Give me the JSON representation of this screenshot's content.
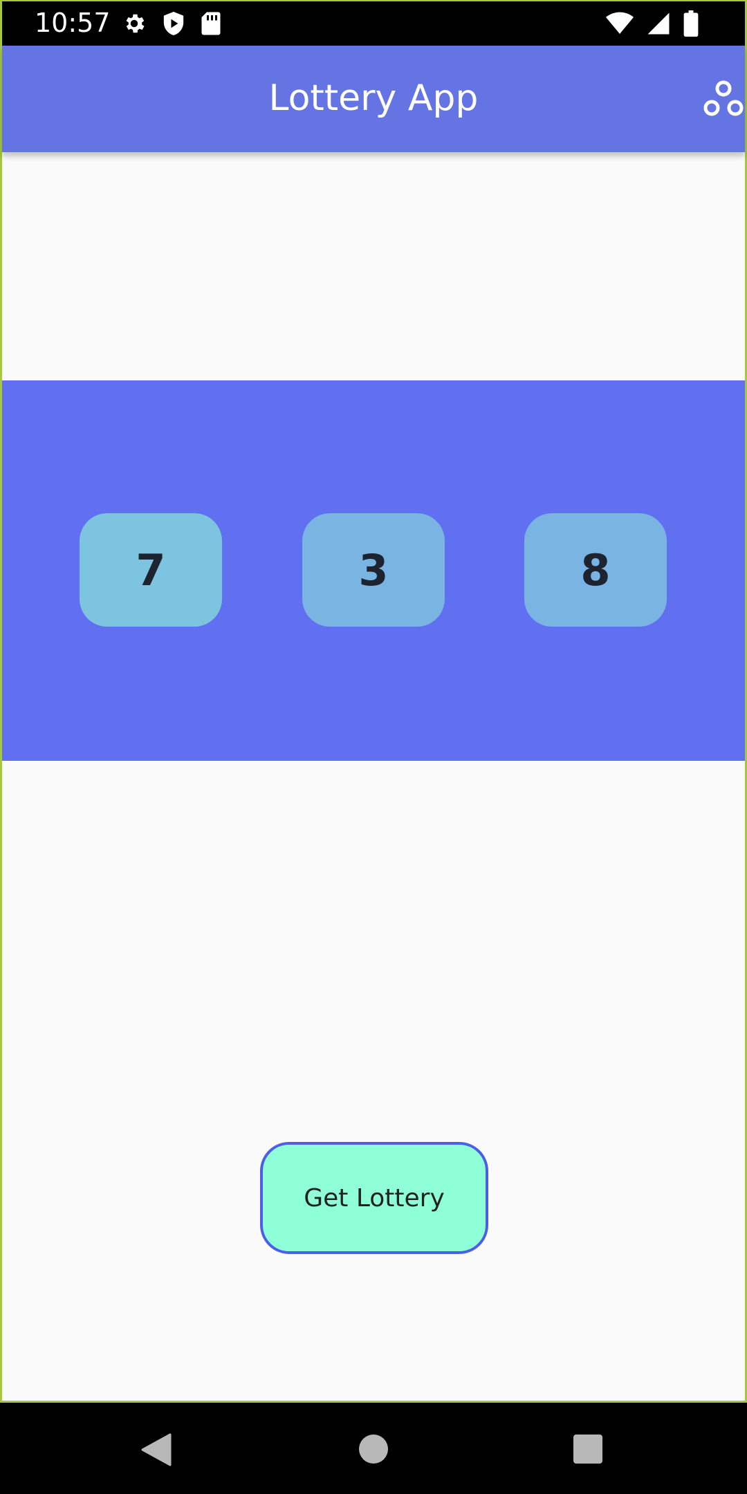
{
  "status_bar": {
    "time": "10:57",
    "left_icons": [
      "gear-icon",
      "play-protect-icon",
      "sd-card-icon"
    ],
    "right_icons": [
      "wifi-icon",
      "signal-icon",
      "battery-icon"
    ]
  },
  "app_bar": {
    "title": "Lottery App",
    "action_icon": "share-icon"
  },
  "lottery": {
    "numbers": [
      "7",
      "3",
      "8"
    ]
  },
  "actions": {
    "get_lottery_label": "Get Lottery"
  },
  "nav_bar": {
    "icons": [
      "back-icon",
      "home-icon",
      "recents-icon"
    ]
  },
  "colors": {
    "app_bar": "#6574e3",
    "band": "#6170f0",
    "button_fill": "#8effd6",
    "button_border": "#4d5ee6",
    "box_1": "#7cc4e0",
    "box_2": "#7ab4e3",
    "box_3": "#7ab4e3"
  }
}
